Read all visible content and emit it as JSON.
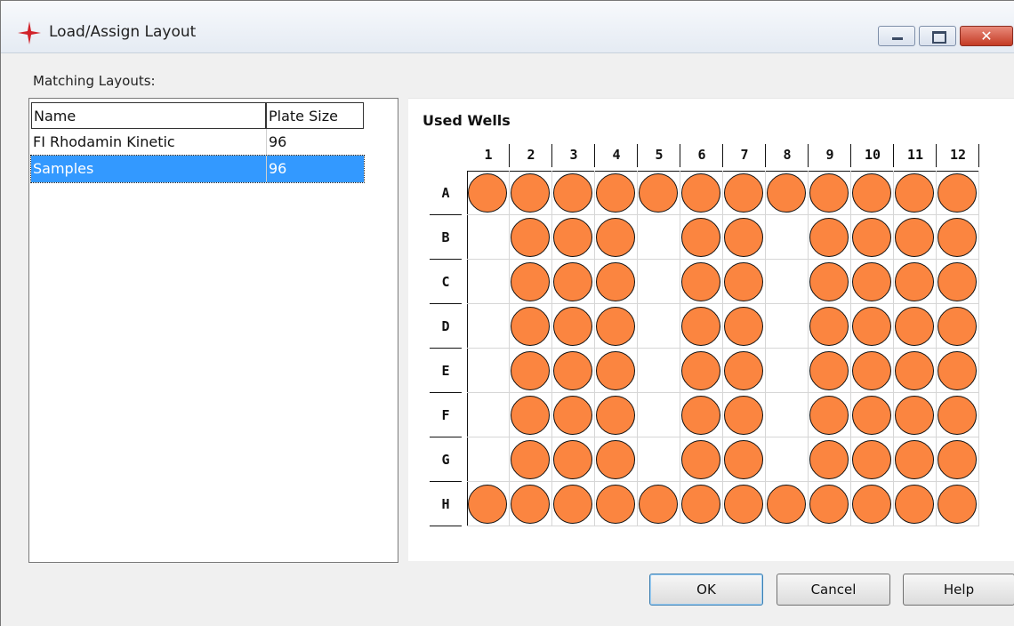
{
  "window": {
    "title": "Load/Assign Layout",
    "accent_color": "#d1232a",
    "controls": {
      "minimize": "minimize-icon",
      "maximize": "maximize-icon",
      "close": "close-icon",
      "close_glyph": "✕"
    }
  },
  "matching": {
    "label": "Matching Layouts:",
    "columns": {
      "name": "Name",
      "plate_size": "Plate Size"
    },
    "rows": [
      {
        "name": "FI Rhodamin Kinetic",
        "plate_size": "96",
        "selected": false
      },
      {
        "name": "Samples",
        "plate_size": "96",
        "selected": true
      }
    ],
    "selection_color": "#3399ff"
  },
  "plate": {
    "title": "Used Wells",
    "well_color": "#fb8540",
    "columns": [
      "1",
      "2",
      "3",
      "4",
      "5",
      "6",
      "7",
      "8",
      "9",
      "10",
      "11",
      "12"
    ],
    "rows": [
      "A",
      "B",
      "C",
      "D",
      "E",
      "F",
      "G",
      "H"
    ],
    "used": [
      [
        1,
        1,
        1,
        1,
        1,
        1,
        1,
        1,
        1,
        1,
        1,
        1
      ],
      [
        0,
        1,
        1,
        1,
        0,
        1,
        1,
        0,
        1,
        1,
        1,
        1
      ],
      [
        0,
        1,
        1,
        1,
        0,
        1,
        1,
        0,
        1,
        1,
        1,
        1
      ],
      [
        0,
        1,
        1,
        1,
        0,
        1,
        1,
        0,
        1,
        1,
        1,
        1
      ],
      [
        0,
        1,
        1,
        1,
        0,
        1,
        1,
        0,
        1,
        1,
        1,
        1
      ],
      [
        0,
        1,
        1,
        1,
        0,
        1,
        1,
        0,
        1,
        1,
        1,
        1
      ],
      [
        0,
        1,
        1,
        1,
        0,
        1,
        1,
        0,
        1,
        1,
        1,
        1
      ],
      [
        1,
        1,
        1,
        1,
        1,
        1,
        1,
        1,
        1,
        1,
        1,
        1
      ]
    ]
  },
  "buttons": {
    "ok": "OK",
    "cancel": "Cancel",
    "help": "Help"
  }
}
